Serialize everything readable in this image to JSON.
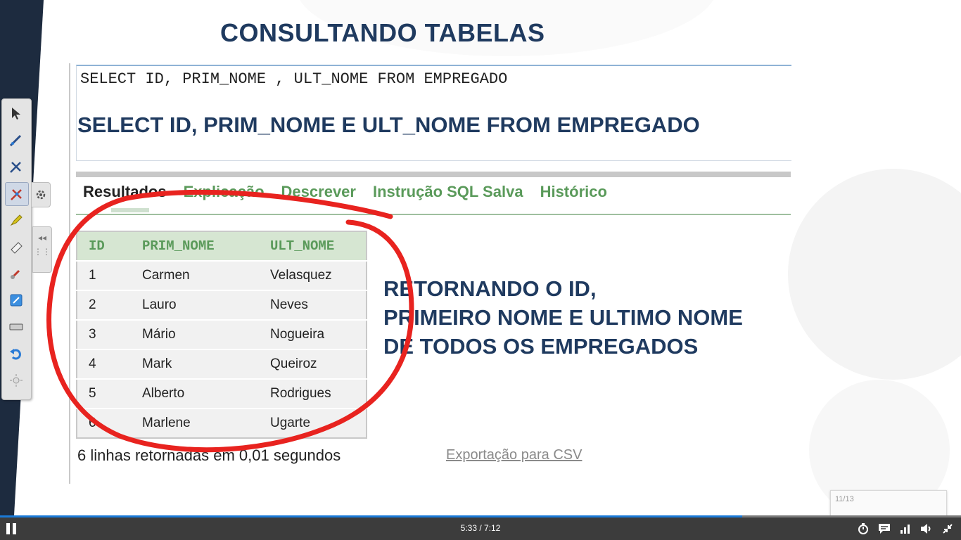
{
  "slide": {
    "title": "CONSULTANDO TABELAS",
    "sql_code": "SELECT ID, PRIM_NOME , ULT_NOME FROM EMPREGADO",
    "sql_main": "SELECT ID, PRIM_NOME E ULT_NOME FROM EMPREGADO",
    "tabs": [
      {
        "label": "Resultados",
        "active": true
      },
      {
        "label": "Explicação",
        "active": false
      },
      {
        "label": "Descrever",
        "active": false
      },
      {
        "label": "Instrução SQL Salva",
        "active": false
      },
      {
        "label": "Histórico",
        "active": false
      }
    ],
    "table": {
      "columns": [
        "ID",
        "PRIM_NOME",
        "ULT_NOME"
      ],
      "rows": [
        [
          "1",
          "Carmen",
          "Velasquez"
        ],
        [
          "2",
          "Lauro",
          "Neves"
        ],
        [
          "3",
          "Mário",
          "Nogueira"
        ],
        [
          "4",
          "Mark",
          "Queiroz"
        ],
        [
          "5",
          "Alberto",
          "Rodrigues"
        ],
        [
          "6",
          "Marlene",
          "Ugarte"
        ]
      ]
    },
    "rows_info": "6 linhas retornadas em 0,01 segundos",
    "export_link": "Exportação para CSV",
    "note_lines": [
      "RETORNANDO O ID,",
      "PRIMEIRO NOME E ULTIMO NOME",
      "DE TODOS OS EMPREGADOS"
    ]
  },
  "annotation": {
    "color": "#e8231f"
  },
  "page_popup": {
    "label": "11/13"
  },
  "player": {
    "time": "5:33 / 7:12",
    "progress_fraction": 0.772,
    "accent": "#1a7ad8",
    "icons": [
      "timer-icon",
      "captions-icon",
      "quality-icon",
      "volume-icon",
      "fullscreen-exit-icon"
    ]
  },
  "toolbox": {
    "tools": [
      "select-arrow-icon",
      "pen-icon",
      "pen-alt-icon",
      "highlight-pen-icon",
      "marker-icon",
      "eraser-icon",
      "clear-icon",
      "whiteboard-icon",
      "keyboard-icon",
      "undo-icon",
      "settings-sun-icon"
    ]
  }
}
